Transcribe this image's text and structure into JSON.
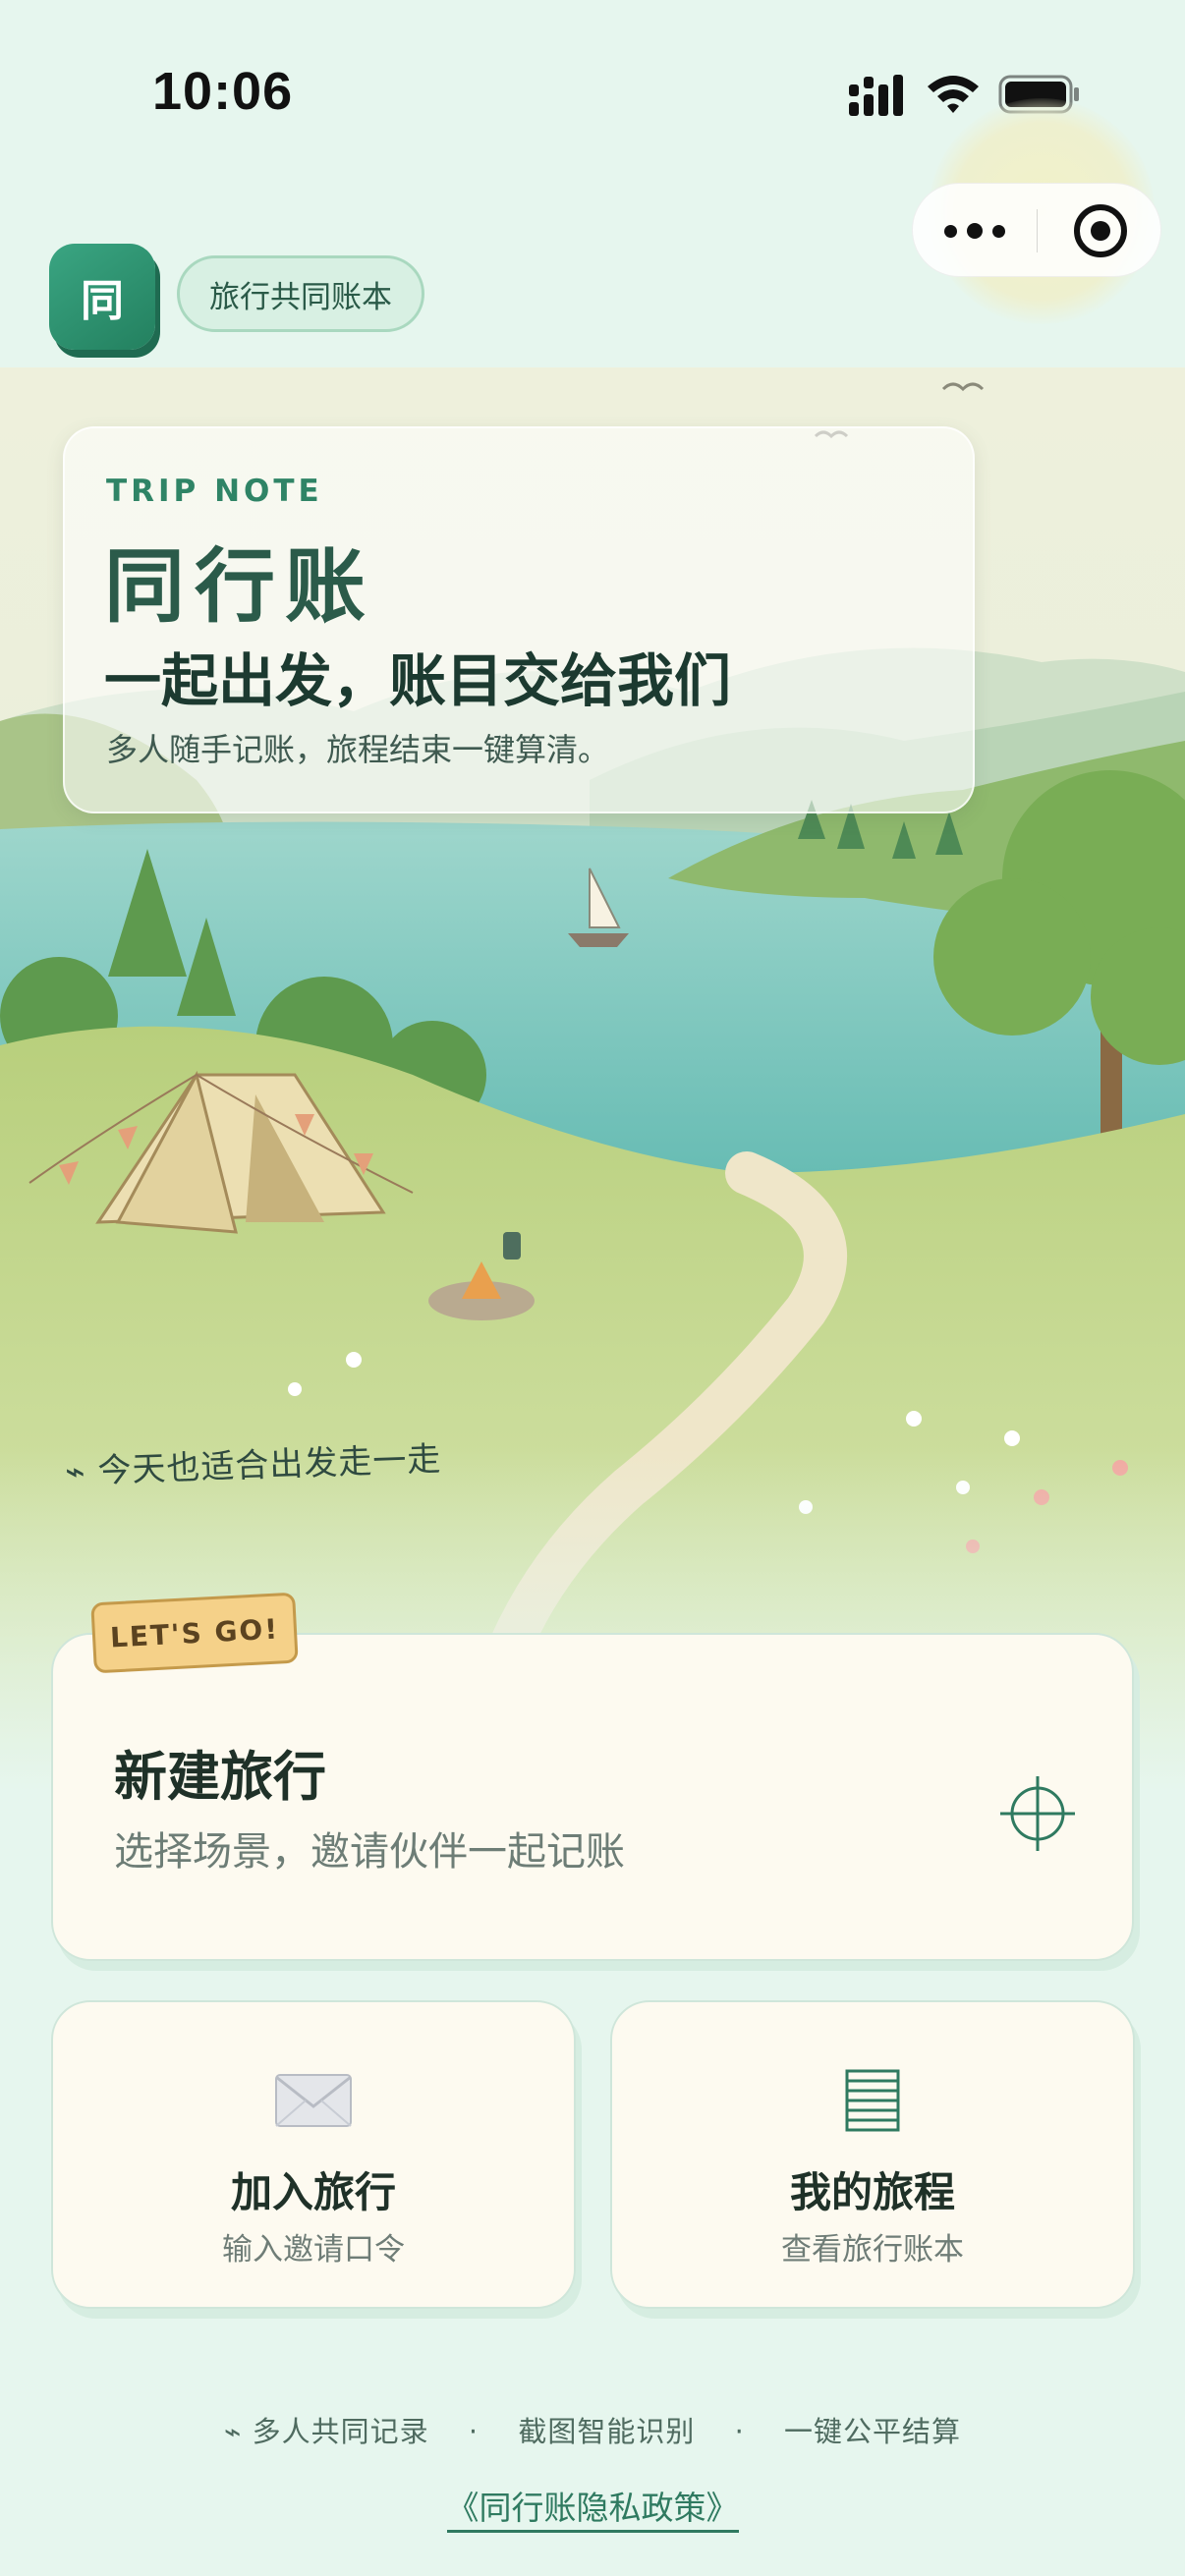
{
  "status_bar": {
    "time": "10:06"
  },
  "header": {
    "logo_text": "同",
    "app_tag": "旅行共同账本"
  },
  "hero": {
    "kicker": "TRIP NOTE",
    "title": "同行账",
    "subtitle": "一起出发，账目交给我们",
    "description": "多人随手记账，旅程结束一键算清。",
    "note": "⌁ 今天也适合出发走一走"
  },
  "new_trip": {
    "badge": "LET'S GO!",
    "title": "新建旅行",
    "subtitle": "选择场景，邀请伙伴一起记账",
    "icon": "crosshair-icon"
  },
  "join_trip": {
    "title": "加入旅行",
    "subtitle": "输入邀请口令",
    "icon": "envelope-icon"
  },
  "my_trips": {
    "title": "我的旅程",
    "subtitle": "查看旅行账本",
    "icon": "ledger-icon"
  },
  "footer": {
    "features": [
      "⌁ 多人共同记录",
      "截图智能识别",
      "一键公平结算"
    ],
    "separator": "·",
    "policy": "《同行账隐私政策》"
  },
  "colors": {
    "brand": "#2f8466",
    "background": "#e6f6ee",
    "card": "#fdfaf0",
    "badge": "#f5d189"
  }
}
